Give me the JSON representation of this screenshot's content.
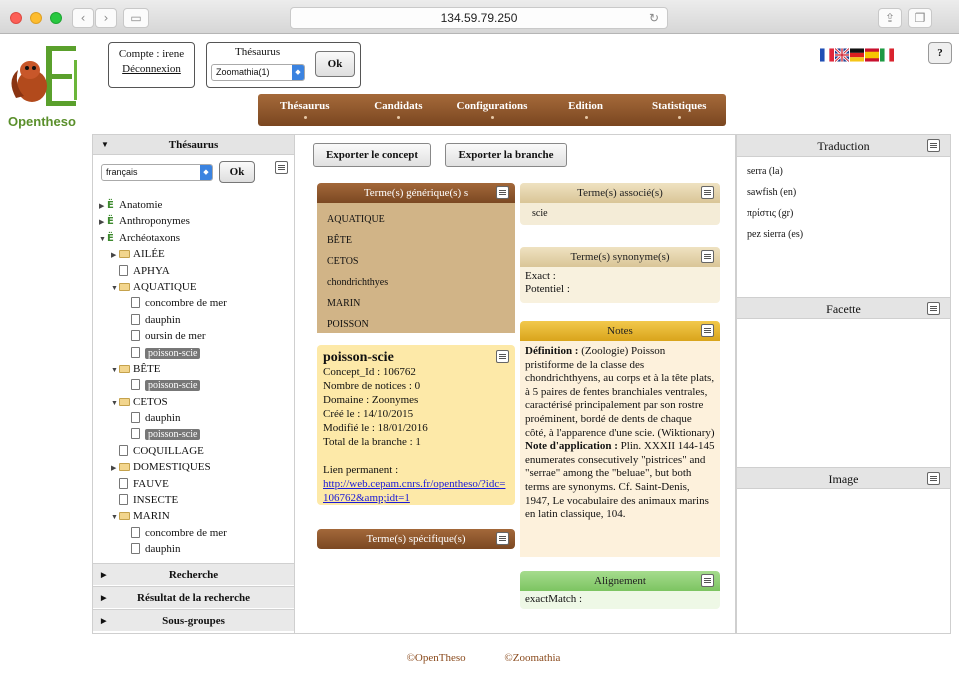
{
  "browser": {
    "url": "134.59.79.250"
  },
  "header": {
    "logo_text": "Opentheso",
    "account_label": "Compte : irene",
    "logout_label": "Déconnexion",
    "thesaurus_label": "Thésaurus",
    "thesaurus_selected": "Zoomathia(1)",
    "ok_label": "Ok",
    "help_label": "?",
    "flags": [
      {
        "name": "fr-flag",
        "colors": [
          "#1f4fb5",
          "#ffffff",
          "#e0263a"
        ]
      },
      {
        "name": "uk-flag",
        "colors": [
          "#203f8f",
          "#ffffff",
          "#cc1f2f"
        ]
      },
      {
        "name": "de-flag",
        "colors": [
          "#111111",
          "#dd1f1f",
          "#f5c518"
        ]
      },
      {
        "name": "es-flag",
        "colors": [
          "#c8102e",
          "#f7c600",
          "#c8102e"
        ]
      },
      {
        "name": "it-flag",
        "colors": [
          "#1d9a43",
          "#ffffff",
          "#d9232e"
        ]
      }
    ]
  },
  "mainmenu": [
    "Thésaurus",
    "Candidats",
    "Configurations",
    "Edition",
    "Statistiques"
  ],
  "leftpanel": {
    "header": "Thésaurus",
    "language": "français",
    "ok_label": "Ok",
    "tree": [
      {
        "label": "Anatomie",
        "level": 0,
        "type": "root",
        "toggle": "▶"
      },
      {
        "label": "Anthroponymes",
        "level": 0,
        "type": "root",
        "toggle": "▶"
      },
      {
        "label": "Archéotaxons",
        "level": 0,
        "type": "root",
        "toggle": "▼"
      },
      {
        "label": "AILÉE",
        "level": 1,
        "type": "folder",
        "toggle": "▶"
      },
      {
        "label": "APHYA",
        "level": 1,
        "type": "doc",
        "toggle": ""
      },
      {
        "label": "AQUATIQUE",
        "level": 1,
        "type": "folder-open",
        "toggle": "▼"
      },
      {
        "label": "concombre de mer",
        "level": 2,
        "type": "doc",
        "toggle": ""
      },
      {
        "label": "dauphin",
        "level": 2,
        "type": "doc",
        "toggle": ""
      },
      {
        "label": "oursin de mer",
        "level": 2,
        "type": "doc",
        "toggle": ""
      },
      {
        "label": "poisson-scie",
        "level": 2,
        "type": "doc-selected",
        "toggle": ""
      },
      {
        "label": "BÊTE",
        "level": 1,
        "type": "folder-open",
        "toggle": "▼"
      },
      {
        "label": "poisson-scie",
        "level": 2,
        "type": "doc-selected",
        "toggle": ""
      },
      {
        "label": "CETOS",
        "level": 1,
        "type": "folder-open",
        "toggle": "▼"
      },
      {
        "label": "dauphin",
        "level": 2,
        "type": "doc",
        "toggle": ""
      },
      {
        "label": "poisson-scie",
        "level": 2,
        "type": "doc-selected",
        "toggle": ""
      },
      {
        "label": "COQUILLAGE",
        "level": 1,
        "type": "doc",
        "toggle": ""
      },
      {
        "label": "DOMESTIQUES",
        "level": 1,
        "type": "folder",
        "toggle": "▶"
      },
      {
        "label": "FAUVE",
        "level": 1,
        "type": "doc",
        "toggle": ""
      },
      {
        "label": "INSECTE",
        "level": 1,
        "type": "doc",
        "toggle": ""
      },
      {
        "label": "MARIN",
        "level": 1,
        "type": "folder-open",
        "toggle": "▼"
      },
      {
        "label": "concombre de mer",
        "level": 2,
        "type": "doc",
        "toggle": ""
      },
      {
        "label": "dauphin",
        "level": 2,
        "type": "doc",
        "toggle": ""
      }
    ],
    "sections": [
      "Recherche",
      "Résultat de la recherche",
      "Sous-groupes"
    ]
  },
  "center": {
    "export_concept": "Exporter le concept",
    "export_branch": "Exporter la branche",
    "generic": {
      "header": "Terme(s) générique(s) s",
      "items": [
        "AQUATIQUE",
        "BÊTE",
        "CETOS",
        "chondrichthyes",
        "MARIN",
        "POISSON"
      ]
    },
    "associated": {
      "header": "Terme(s) associé(s)",
      "items": [
        "scie"
      ]
    },
    "synonyms": {
      "header": "Terme(s) synonyme(s)",
      "exact": "Exact :",
      "potential": "Potentiel :"
    },
    "concept": {
      "title": "poisson-scie",
      "concept_id": "Concept_Id : 106762",
      "notices": "Nombre de notices : 0",
      "domain": "Domaine : Zoonymes",
      "created": "Créé le : 14/10/2015",
      "modified": "Modifié le : 18/01/2016",
      "branch_total": "Total de la branche : 1",
      "permalink_label": "Lien permanent :",
      "permalink": "http://web.cepam.cnrs.fr/opentheso/?idc=106762&amp;idt=1"
    },
    "specific": {
      "header": "Terme(s) spécifique(s)"
    },
    "notes": {
      "header": "Notes",
      "definition_label": "Définition :",
      "definition_text": " (Zoologie) Poisson pristiforme de la classe des chondrichthyens, au corps et à la tête plats, à 5 paires de fentes branchiales ventrales, caractérisé principalement par son rostre proéminent, bordé de dents de chaque côté, à l'apparence d'une scie. (Wiktionary)",
      "application_label": "Note d'application :",
      "application_text": " Plin. XXXII 144-145 enumerates consecutively \"pistrices\" and \"serrae\" among the \"beluae\", but both terms are synonyms. Cf. Saint-Denis, 1947, Le vocabulaire des animaux marins en latin classique, 104."
    },
    "alignment": {
      "header": "Alignement",
      "exact_match": "exactMatch :"
    }
  },
  "rightpanel": {
    "translation_header": "Traduction",
    "translations": [
      "serra (la)",
      "sawfish (en)",
      "πρίστις (gr)",
      "pez sierra (es)"
    ],
    "facet_header": "Facette",
    "image_header": "Image"
  },
  "footer": {
    "left": "©OpenTheso",
    "right": "©Zoomathia"
  }
}
